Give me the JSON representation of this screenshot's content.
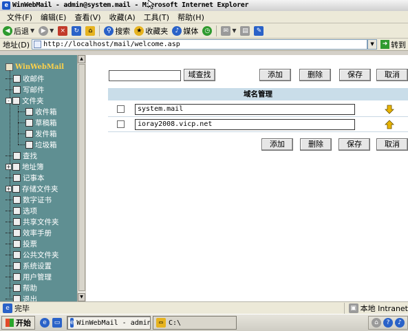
{
  "window": {
    "title": "WinWebMail - admin@system.mail - Microsoft Internet Explorer"
  },
  "menu": [
    "文件(F)",
    "编辑(E)",
    "查看(V)",
    "收藏(A)",
    "工具(T)",
    "帮助(H)"
  ],
  "toolbar": {
    "back_label": "后退",
    "search_label": "搜索",
    "favorites_label": "收藏夹",
    "media_label": "媒体"
  },
  "address": {
    "label": "地址(D)",
    "url": "http://localhost/mail/welcome.asp",
    "go_label": "转到"
  },
  "sidebar": {
    "logo": "WinWebMail",
    "items": [
      {
        "label": "收邮件",
        "icon": "inbox-icon",
        "level": 0
      },
      {
        "label": "写邮件",
        "icon": "compose-icon",
        "level": 0
      },
      {
        "label": "文件夹",
        "icon": "folder-icon",
        "level": 0,
        "expander": "-"
      },
      {
        "label": "收件箱",
        "icon": "inbox-folder-icon",
        "level": 1
      },
      {
        "label": "草稿箱",
        "icon": "drafts-folder-icon",
        "level": 1
      },
      {
        "label": "发件箱",
        "icon": "sent-folder-icon",
        "level": 1
      },
      {
        "label": "垃圾箱",
        "icon": "trash-folder-icon",
        "level": 1
      },
      {
        "label": "查找",
        "icon": "search-icon",
        "level": 0
      },
      {
        "label": "地址簿",
        "icon": "address-book-icon",
        "level": 0,
        "expander": "+"
      },
      {
        "label": "记事本",
        "icon": "notepad-icon",
        "level": 0
      },
      {
        "label": "存储文件夹",
        "icon": "storage-folder-icon",
        "level": 0,
        "expander": "+"
      },
      {
        "label": "数字证书",
        "icon": "certificate-icon",
        "level": 0
      },
      {
        "label": "选项",
        "icon": "options-icon",
        "level": 0
      },
      {
        "label": "共享文件夹",
        "icon": "shared-folder-icon",
        "level": 0
      },
      {
        "label": "效率手册",
        "icon": "handbook-icon",
        "level": 0
      },
      {
        "label": "投票",
        "icon": "vote-icon",
        "level": 0
      },
      {
        "label": "公共文件夹",
        "icon": "public-folder-icon",
        "level": 0
      },
      {
        "label": "系统设置",
        "icon": "settings-icon",
        "level": 0
      },
      {
        "label": "用户管理",
        "icon": "user-admin-icon",
        "level": 0
      },
      {
        "label": "帮助",
        "icon": "help-icon",
        "level": 0
      },
      {
        "label": "退出",
        "icon": "logout-icon",
        "level": 0
      }
    ]
  },
  "main": {
    "search_button": "域查找",
    "search_value": "",
    "buttons": {
      "add": "添加",
      "delete": "删除",
      "save": "保存",
      "cancel": "取消"
    },
    "table_title": "域名管理",
    "rows": [
      {
        "domain": "system.mail",
        "arrow": "down"
      },
      {
        "domain": "ioray2008.vicp.net",
        "arrow": "up"
      }
    ]
  },
  "status": {
    "left": "完毕",
    "zone": "本地 Intranet"
  },
  "taskbar": {
    "start": "开始",
    "tasks": [
      "WinWebMail - admin@...",
      "C:\\"
    ]
  },
  "colors": {
    "sidebar_bg": "#5f8f92",
    "table_header_bg": "#c9dde9",
    "arrow_color": "#e8b400"
  }
}
